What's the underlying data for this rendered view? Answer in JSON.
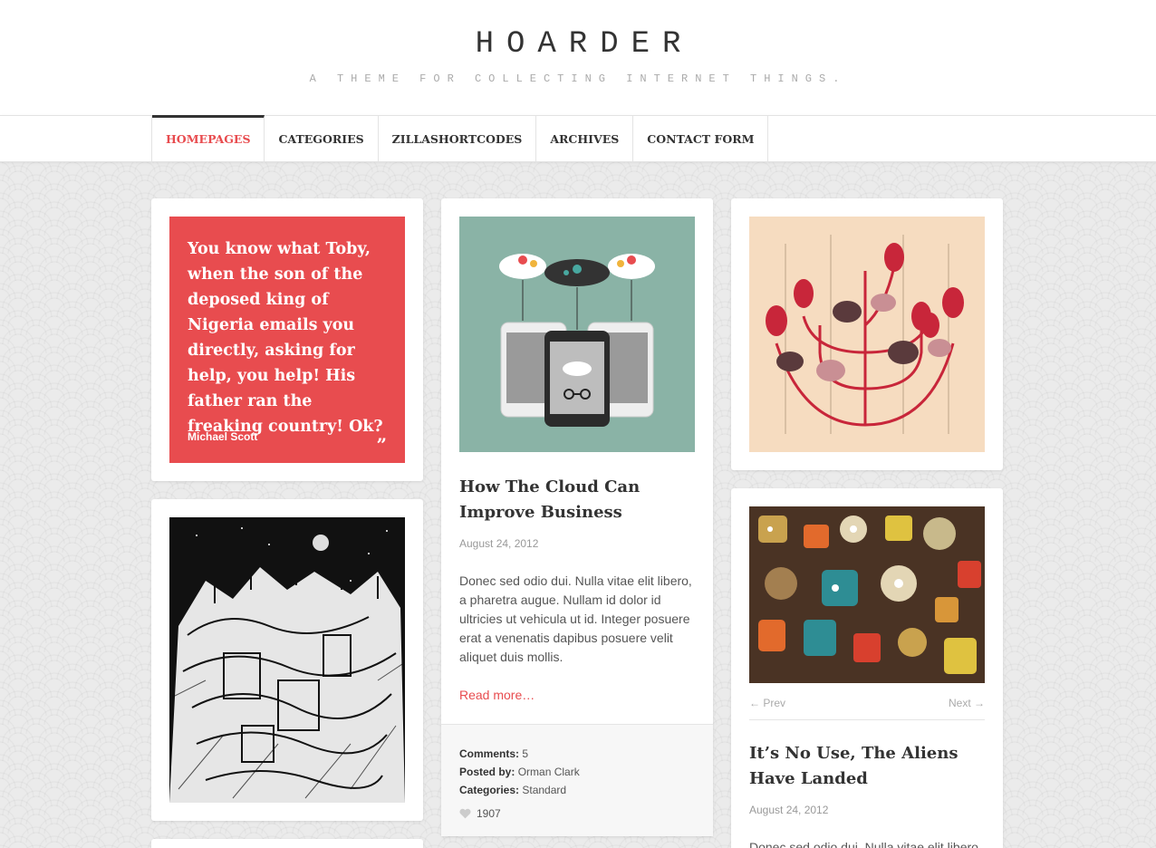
{
  "site": {
    "title": "HOARDER",
    "tagline": "A THEME FOR COLLECTING INTERNET THINGS."
  },
  "nav": {
    "items": [
      {
        "label": "HOMEPAGES",
        "active": true
      },
      {
        "label": "CATEGORIES"
      },
      {
        "label": "ZILLASHORTCODES"
      },
      {
        "label": "ARCHIVES"
      },
      {
        "label": "CONTACT FORM"
      }
    ]
  },
  "colors": {
    "accent": "#e84c4f",
    "text": "#333333"
  },
  "quote_post": {
    "text": "You know what Toby, when the son of the deposed king of Nigeria emails you directly, asking for help, you help! His father ran the freaking country! Ok?",
    "author": "Michael Scott",
    "mark": "”"
  },
  "image_post_city": {
    "image": "ink-illustration-city"
  },
  "cloud_post": {
    "image": "cloud-devices-illustration",
    "title": "How The Cloud Can Improve Business",
    "date": "August 24, 2012",
    "excerpt": "Donec sed odio dui. Nulla vitae elit libero, a pharetra augue. Nullam id dolor id ultricies ut vehicula ut id. Integer posuere erat a venenatis dapibus posuere velit aliquet duis mollis.",
    "read_more": "Read more…",
    "comments_label": "Comments:",
    "comments": "5",
    "posted_by_label": "Posted by:",
    "posted_by": "Orman Clark",
    "categories_label": "Categories:",
    "categories": "Standard",
    "likes": "1907"
  },
  "image_post_birds": {
    "image": "birds-tree-illustration"
  },
  "gallery_post": {
    "image": "robots-pattern-illustration",
    "prev": "← Prev",
    "next": "Next →",
    "title": "It’s No Use, The Aliens Have Landed",
    "date": "August 24, 2012",
    "excerpt": "Donec sed odio dui. Nulla vitae elit libero"
  }
}
